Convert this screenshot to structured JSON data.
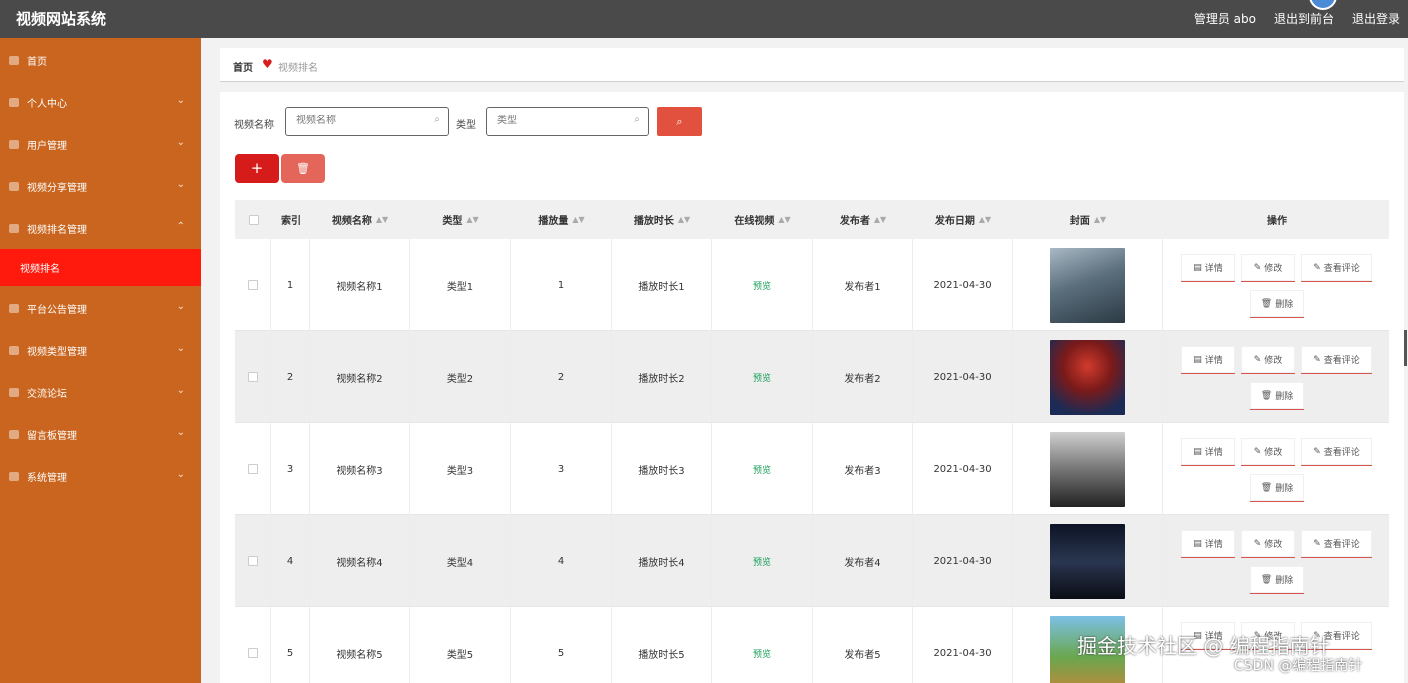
{
  "header": {
    "app_title": "视频网站系统",
    "user_label": "管理员 abo",
    "to_front": "退出到前台",
    "logout": "退出登录"
  },
  "sidebar": {
    "items": [
      {
        "label": "首页",
        "icon": "home-icon",
        "expandable": false
      },
      {
        "label": "个人中心",
        "icon": "user-icon",
        "expandable": true
      },
      {
        "label": "用户管理",
        "icon": "list-icon",
        "expandable": true
      },
      {
        "label": "视频分享管理",
        "icon": "share-icon",
        "expandable": true
      },
      {
        "label": "视频排名管理",
        "icon": "chart-icon",
        "expandable": true,
        "expanded": true
      },
      {
        "label": "平台公告管理",
        "icon": "bell-icon",
        "expandable": true
      },
      {
        "label": "视频类型管理",
        "icon": "tag-icon",
        "expandable": true
      },
      {
        "label": "交流论坛",
        "icon": "forum-icon",
        "expandable": true
      },
      {
        "label": "留言板管理",
        "icon": "message-icon",
        "expandable": true
      },
      {
        "label": "系统管理",
        "icon": "settings-icon",
        "expandable": true
      }
    ],
    "active_sub": "视频排名"
  },
  "breadcrumb": {
    "home": "首页",
    "current": "视频排名"
  },
  "search": {
    "name_label": "视频名称",
    "name_placeholder": "视频名称",
    "type_label": "类型",
    "type_placeholder": "类型"
  },
  "toolbar": {
    "add_label": "+",
    "delete_icon": "trash-icon"
  },
  "table": {
    "columns": [
      "索引",
      "视频名称",
      "类型",
      "播放量",
      "播放时长",
      "在线视频",
      "发布者",
      "发布日期",
      "封面",
      "操作"
    ],
    "rows": [
      {
        "index": "1",
        "name": "视频名称1",
        "type": "类型1",
        "plays": "1",
        "duration": "播放时长1",
        "online": "预览",
        "publisher": "发布者1",
        "date": "2021-04-30"
      },
      {
        "index": "2",
        "name": "视频名称2",
        "type": "类型2",
        "plays": "2",
        "duration": "播放时长2",
        "online": "预览",
        "publisher": "发布者2",
        "date": "2021-04-30"
      },
      {
        "index": "3",
        "name": "视频名称3",
        "type": "类型3",
        "plays": "3",
        "duration": "播放时长3",
        "online": "预览",
        "publisher": "发布者3",
        "date": "2021-04-30"
      },
      {
        "index": "4",
        "name": "视频名称4",
        "type": "类型4",
        "plays": "4",
        "duration": "播放时长4",
        "online": "预览",
        "publisher": "发布者4",
        "date": "2021-04-30"
      },
      {
        "index": "5",
        "name": "视频名称5",
        "type": "类型5",
        "plays": "5",
        "duration": "播放时长5",
        "online": "预览",
        "publisher": "发布者5",
        "date": "2021-04-30"
      }
    ],
    "actions": {
      "detail": "详情",
      "edit": "修改",
      "comments": "查看评论",
      "delete": "删除"
    }
  },
  "watermark": {
    "line1": "掘金技术社区 @ 编程指南针",
    "line2": "CSDN @编程指南针"
  },
  "colors": {
    "header_bg": "#4a4a4a",
    "sidebar_bg": "#c9651e",
    "active_bg": "#ff1a0d",
    "accent_red": "#d61b1b",
    "preview_green": "#1a9e5a"
  }
}
